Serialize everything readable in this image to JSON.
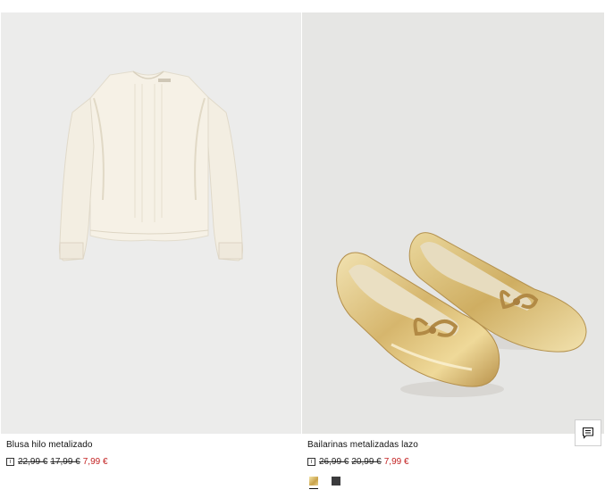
{
  "products": [
    {
      "name": "Blusa hilo metalizado",
      "info_icon": "info-icon",
      "price_original": "22,99 €",
      "price_previous": "17,99 €",
      "price_sale": "7,99 €"
    },
    {
      "name": "Bailarinas metalizadas lazo",
      "info_icon": "info-icon",
      "price_original": "26,99 €",
      "price_previous": "20,99 €",
      "price_sale": "7,99 €",
      "swatches": [
        {
          "color": "#d4b366",
          "selected": true
        },
        {
          "color": "#3b3b3d",
          "selected": false
        }
      ]
    }
  ],
  "chat_button_icon": "chat-icon",
  "colors": {
    "sale": "#c32222",
    "background_left": "#ececeb",
    "background_right": "#e6e6e4"
  }
}
